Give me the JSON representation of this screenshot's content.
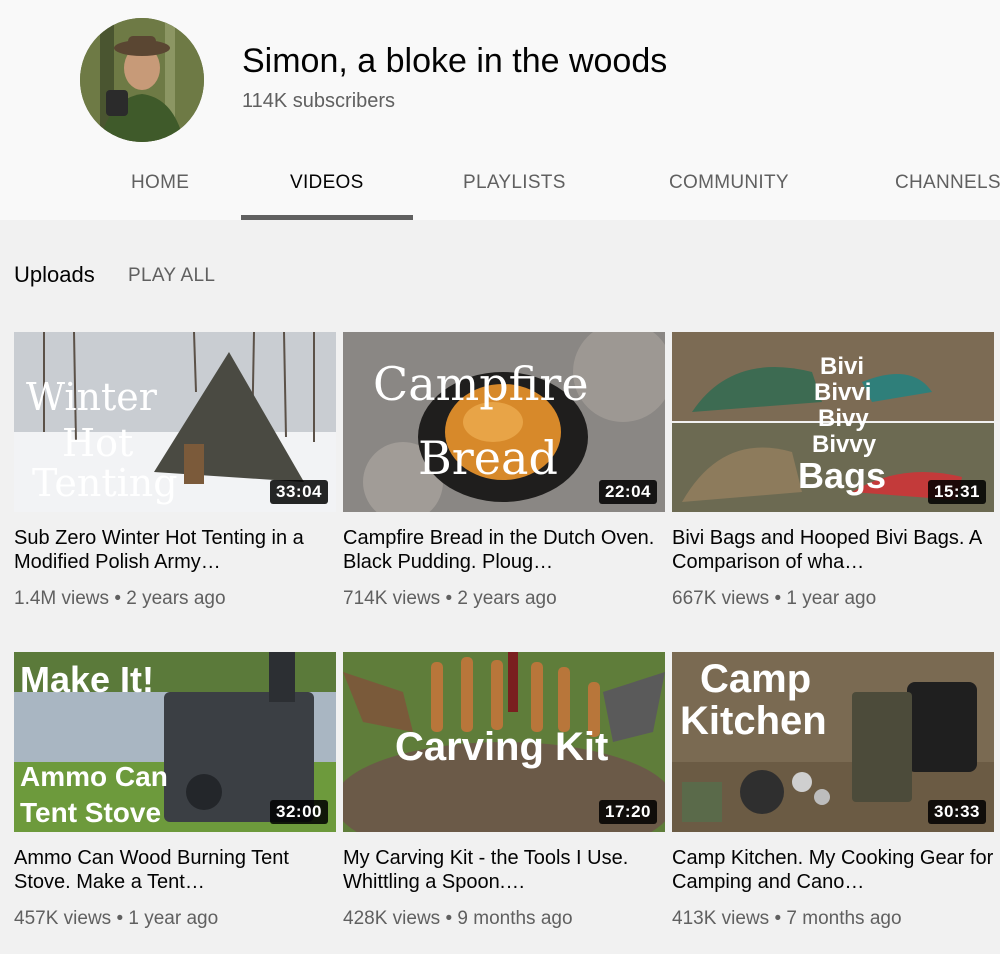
{
  "channel": {
    "name": "Simon, a bloke in the woods",
    "subscribers": "114K subscribers"
  },
  "tabs": [
    {
      "label": "HOME"
    },
    {
      "label": "VIDEOS"
    },
    {
      "label": "PLAYLISTS"
    },
    {
      "label": "COMMUNITY"
    },
    {
      "label": "CHANNELS"
    }
  ],
  "active_tab": "VIDEOS",
  "section": {
    "title": "Uploads",
    "play_all": "PLAY ALL"
  },
  "videos": [
    {
      "title": "Sub Zero Winter Hot Tenting in a Modified Polish Army…",
      "views": "1.4M views",
      "age": "2 years ago",
      "duration": "33:04",
      "thumb_text": [
        "Winter",
        "Hot",
        "Tenting"
      ]
    },
    {
      "title": "Campfire Bread in the Dutch Oven. Black Pudding. Ploug…",
      "views": "714K views",
      "age": "2 years ago",
      "duration": "22:04",
      "thumb_text": [
        "Campfire",
        "Bread"
      ]
    },
    {
      "title": "Bivi Bags and Hooped Bivi Bags. A Comparison of wha…",
      "views": "667K views",
      "age": "1 year ago",
      "duration": "15:31",
      "thumb_text": [
        "Bivi",
        "Bivvi",
        "Bivy",
        "Bivvy",
        "Bags"
      ]
    },
    {
      "title": "Ammo Can Wood Burning Tent Stove. Make a Tent…",
      "views": "457K views",
      "age": "1 year ago",
      "duration": "32:00",
      "thumb_text": [
        "Make It!",
        "Ammo Can",
        "Tent Stove"
      ]
    },
    {
      "title": "My Carving Kit - the Tools I Use. Whittling a Spoon.…",
      "views": "428K views",
      "age": "9 months ago",
      "duration": "17:20",
      "thumb_text": [
        "Carving Kit"
      ]
    },
    {
      "title": "Camp Kitchen. My Cooking Gear for Camping and Cano…",
      "views": "413K views",
      "age": "7 months ago",
      "duration": "30:33",
      "thumb_text": [
        "Camp",
        "Kitchen"
      ]
    }
  ],
  "separator": "•",
  "colors": {
    "header_bg": "#f9f9f9",
    "page_bg": "#f1f1f1",
    "text_primary": "#030303",
    "text_secondary": "#606060",
    "tab_underline": "#606060"
  }
}
